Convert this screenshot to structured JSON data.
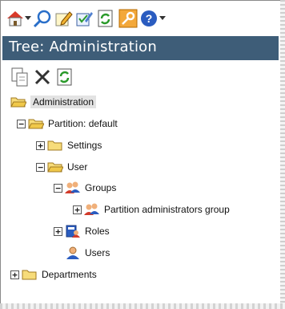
{
  "toolbar": {
    "icons": [
      "home-icon",
      "search-icon",
      "edit-icon",
      "check-edit-icon",
      "refresh-icon",
      "key-icon",
      "help-icon"
    ]
  },
  "panel": {
    "title": "Tree: Administration"
  },
  "actions": {
    "icons": [
      "copy-icon",
      "delete-icon",
      "refresh-icon"
    ]
  },
  "tree": {
    "root": "Administration",
    "partition": "Partition: default",
    "settings": "Settings",
    "user": "User",
    "groups": "Groups",
    "partition_admins": "Partition administrators group",
    "roles": "Roles",
    "users": "Users",
    "departments": "Departments"
  },
  "colors": {
    "header_bg": "#3e5d78",
    "header_text": "#ffffff",
    "folder": "#f0c84a"
  }
}
